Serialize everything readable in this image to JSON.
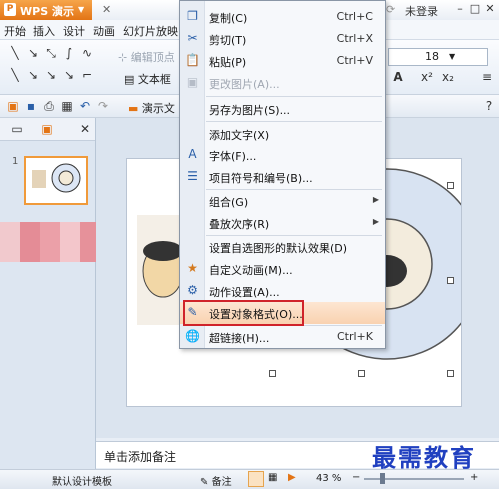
{
  "app": {
    "title": "WPS 演示",
    "login": "未登录"
  },
  "menus": [
    "开始",
    "插入",
    "设计",
    "动画",
    "幻灯片放映"
  ],
  "ribbon": {
    "edit_vertex": "编辑顶点",
    "textbox": "文本框",
    "font_size": "18",
    "presentation_prefix": "演示文"
  },
  "context_menu": {
    "items": [
      {
        "label": "复制(C)",
        "shortcut": "Ctrl+C",
        "icon": "copy-icon"
      },
      {
        "label": "剪切(T)",
        "shortcut": "Ctrl+X",
        "icon": "cut-icon"
      },
      {
        "label": "粘贴(P)",
        "shortcut": "Ctrl+V",
        "icon": "paste-icon"
      },
      {
        "label": "更改图片(A)...",
        "shortcut": "",
        "disabled": true
      },
      {
        "label": "另存为图片(S)...",
        "shortcut": ""
      },
      {
        "label": "添加文字(X)",
        "shortcut": ""
      },
      {
        "label": "字体(F)...",
        "shortcut": "",
        "icon": "font-icon"
      },
      {
        "label": "项目符号和编号(B)...",
        "shortcut": "",
        "icon": "bullets-icon"
      },
      {
        "label": "组合(G)",
        "shortcut": "",
        "submenu": true
      },
      {
        "label": "叠放次序(R)",
        "shortcut": "",
        "submenu": true
      },
      {
        "label": "设置自选图形的默认效果(D)",
        "shortcut": ""
      },
      {
        "label": "自定义动画(M)...",
        "shortcut": "",
        "icon": "animation-icon"
      },
      {
        "label": "动作设置(A)...",
        "shortcut": "",
        "icon": "action-icon"
      },
      {
        "label": "设置对象格式(O)...",
        "shortcut": "",
        "icon": "format-icon",
        "highlighted": true
      },
      {
        "label": "超链接(H)...",
        "shortcut": "Ctrl+K",
        "icon": "hyperlink-icon"
      }
    ]
  },
  "notes": {
    "placeholder": "单击添加备注"
  },
  "status": {
    "template": "默认设计模板",
    "notes_btn": "备注",
    "zoom": "43 %"
  },
  "slide": {
    "number": "1"
  },
  "watermark": "最需教育",
  "colors": {
    "accent": "#e37415",
    "highlight_border": "#d0232a",
    "watermark": "#2040c0"
  }
}
